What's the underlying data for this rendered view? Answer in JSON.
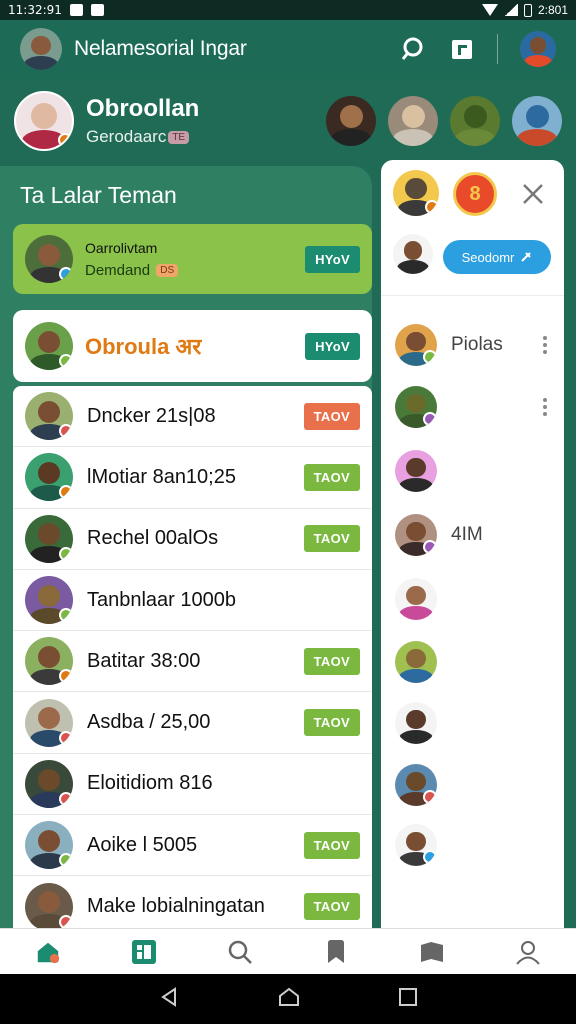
{
  "status_bar": {
    "time": "11:32:91",
    "right_time": "2:801"
  },
  "top_bar": {
    "title": "Nelamesorial Ingar"
  },
  "profile": {
    "name": "Obroollan",
    "subtitle": "Gerodaarc",
    "tag": "TE"
  },
  "section_title": "Ta Lalar Teman",
  "featured": [
    {
      "line1": "Oarrolivtam",
      "line2": "Demdand",
      "tag": "DS",
      "button": "HYoV"
    },
    {
      "title": "Obroula अर",
      "button": "HYoV"
    }
  ],
  "contacts": [
    {
      "label": "Dncker 21s|08",
      "button": "TAOV",
      "button_color": "orange"
    },
    {
      "label": "lMotiar 8an10;25",
      "button": "TAOV",
      "button_color": "green"
    },
    {
      "label": "Rechel 00alOs",
      "button": "TAOV",
      "button_color": "green"
    },
    {
      "label": "Tanbnlaar 1000b",
      "button": "",
      "button_color": ""
    },
    {
      "label": "Batitar 38:00",
      "button": "TAOV",
      "button_color": "green"
    },
    {
      "label": "Asdba / 25,00",
      "button": "TAOV",
      "button_color": "green"
    },
    {
      "label": "Eloitidiom 816",
      "button": "",
      "button_color": ""
    },
    {
      "label": "Aoike l 5005",
      "button": "TAOV",
      "button_color": "green"
    },
    {
      "label": "Make lobialningatan",
      "button": "TAOV",
      "button_color": "green"
    }
  ],
  "right_panel": {
    "button_label": "Seodomr",
    "rows": [
      {
        "label": "Piolas",
        "menu": true
      },
      {
        "label": "",
        "menu": true
      },
      {
        "label": "",
        "menu": false
      },
      {
        "label": "4IM",
        "menu": false
      },
      {
        "label": "",
        "menu": false
      },
      {
        "label": "",
        "menu": false
      },
      {
        "label": "",
        "menu": false
      },
      {
        "label": "",
        "menu": false
      },
      {
        "label": "",
        "menu": false
      }
    ]
  },
  "colors": {
    "primary": "#1d6b57",
    "accent_green": "#8bc34a",
    "teal_button": "#1b8c6f",
    "orange_button": "#e8704a",
    "blue_button": "#2b9fe0"
  }
}
